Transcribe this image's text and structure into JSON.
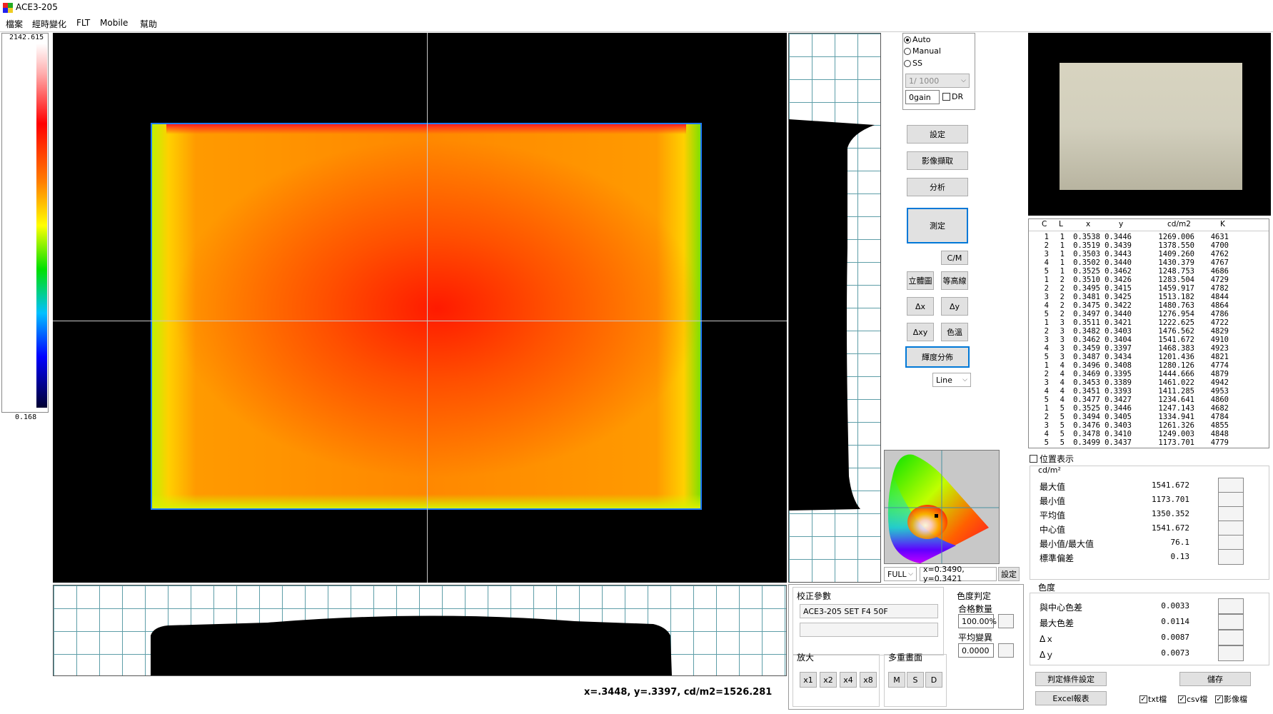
{
  "window": {
    "title": "ACE3-205"
  },
  "menu": [
    "檔案",
    "經時變化",
    "FLT",
    "Mobile",
    "幫助"
  ],
  "colorbar": {
    "max_label": "2142.615",
    "min_label": "0.168"
  },
  "exposure": {
    "options": [
      "Auto",
      "Manual",
      "SS"
    ],
    "selected": "Auto",
    "shutter_value": "1/ 1000",
    "gain_value": "0gain",
    "dr_label": "DR",
    "dr_checked": false
  },
  "buttons": {
    "settings": "設定",
    "capture": "影像擷取",
    "analyze": "分析",
    "measure": "測定",
    "cm": "C/M",
    "stereo": "立體圖",
    "contour": "等高線",
    "dx": "Δx",
    "dy": "Δy",
    "dxy": "Δxy",
    "color_temp": "色溫",
    "luminance_dist": "輝度分佈"
  },
  "line_select": "Line",
  "cie": {
    "mode": "FULL",
    "coords": "x=0.3490, y=0.3421",
    "set_button": "設定"
  },
  "calibration": {
    "title": "校正參數",
    "value": "ACE3-205 SET F4   50F"
  },
  "zoom": {
    "title": "放大",
    "buttons": [
      "x1",
      "x2",
      "x4",
      "x8"
    ]
  },
  "multi_screen": {
    "title": "多重畫面",
    "buttons": [
      "M",
      "S",
      "D"
    ]
  },
  "chroma_judge": {
    "title": "色度判定",
    "pass_label": "合格數量",
    "pass_value": "100.00%",
    "avg_label": "平均變異",
    "avg_value": "0.0000"
  },
  "status": {
    "readout": "x=.3448, y=.3397, cd/m2=1526.281"
  },
  "table": {
    "headers": [
      "C",
      "L",
      "x",
      "y",
      "cd/m2",
      "K"
    ],
    "rows": [
      [
        "1",
        "1",
        "0.3538",
        "0.3446",
        "1269.006",
        "4631"
      ],
      [
        "2",
        "1",
        "0.3519",
        "0.3439",
        "1378.550",
        "4700"
      ],
      [
        "3",
        "1",
        "0.3503",
        "0.3443",
        "1409.260",
        "4762"
      ],
      [
        "4",
        "1",
        "0.3502",
        "0.3440",
        "1430.379",
        "4767"
      ],
      [
        "5",
        "1",
        "0.3525",
        "0.3462",
        "1248.753",
        "4686"
      ],
      [
        "1",
        "2",
        "0.3510",
        "0.3426",
        "1283.504",
        "4729"
      ],
      [
        "2",
        "2",
        "0.3495",
        "0.3415",
        "1459.917",
        "4782"
      ],
      [
        "3",
        "2",
        "0.3481",
        "0.3425",
        "1513.182",
        "4844"
      ],
      [
        "4",
        "2",
        "0.3475",
        "0.3422",
        "1480.763",
        "4864"
      ],
      [
        "5",
        "2",
        "0.3497",
        "0.3440",
        "1276.954",
        "4786"
      ],
      [
        "1",
        "3",
        "0.3511",
        "0.3421",
        "1222.625",
        "4722"
      ],
      [
        "2",
        "3",
        "0.3482",
        "0.3403",
        "1476.562",
        "4829"
      ],
      [
        "3",
        "3",
        "0.3462",
        "0.3404",
        "1541.672",
        "4910"
      ],
      [
        "4",
        "3",
        "0.3459",
        "0.3397",
        "1468.383",
        "4923"
      ],
      [
        "5",
        "3",
        "0.3487",
        "0.3434",
        "1201.436",
        "4821"
      ],
      [
        "1",
        "4",
        "0.3496",
        "0.3408",
        "1280.126",
        "4774"
      ],
      [
        "2",
        "4",
        "0.3469",
        "0.3395",
        "1444.666",
        "4879"
      ],
      [
        "3",
        "4",
        "0.3453",
        "0.3389",
        "1461.022",
        "4942"
      ],
      [
        "4",
        "4",
        "0.3451",
        "0.3393",
        "1411.285",
        "4953"
      ],
      [
        "5",
        "4",
        "0.3477",
        "0.3427",
        "1234.641",
        "4860"
      ],
      [
        "1",
        "5",
        "0.3525",
        "0.3446",
        "1247.143",
        "4682"
      ],
      [
        "2",
        "5",
        "0.3494",
        "0.3405",
        "1334.941",
        "4784"
      ],
      [
        "3",
        "5",
        "0.3476",
        "0.3403",
        "1261.326",
        "4855"
      ],
      [
        "4",
        "5",
        "0.3478",
        "0.3410",
        "1249.003",
        "4848"
      ],
      [
        "5",
        "5",
        "0.3499",
        "0.3437",
        "1173.701",
        "4779"
      ]
    ]
  },
  "position_display": "位置表示",
  "luminance": {
    "unit": "cd/m²",
    "rows": [
      {
        "label": "最大值",
        "value": "1541.672"
      },
      {
        "label": "最小值",
        "value": "1173.701"
      },
      {
        "label": "平均值",
        "value": "1350.352"
      },
      {
        "label": "中心值",
        "value": "1541.672"
      },
      {
        "label": "最小值/最大值",
        "value": "76.1"
      },
      {
        "label": "標準偏差",
        "value": "0.13"
      }
    ]
  },
  "chromaticity": {
    "title": "色度",
    "rows": [
      {
        "label": "與中心色差",
        "value": "0.0033"
      },
      {
        "label": "最大色差",
        "value": "0.0114"
      },
      {
        "label": "Δｘ",
        "value": "0.0087"
      },
      {
        "label": "Δｙ",
        "value": "0.0073"
      }
    ]
  },
  "bottom": {
    "judge_settings": "判定條件設定",
    "save": "儲存",
    "excel": "Excel報表",
    "txt": "txt檔",
    "csv": "csv檔",
    "image": "影像檔"
  },
  "colors": {
    "grid_line": "#5e9ea8",
    "focus_border": "#0078d7",
    "crosshair": "#c8c8c8"
  }
}
